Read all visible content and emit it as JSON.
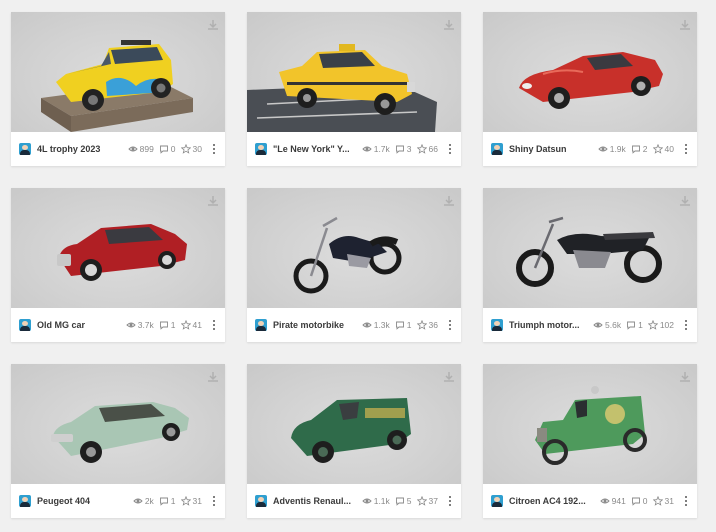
{
  "models": [
    {
      "title": "4L trophy 2023",
      "views": "899",
      "comments": "0",
      "likes": "30",
      "image": "yellow-renault-4l-on-pallet"
    },
    {
      "title": "\"Le New York\" Y...",
      "views": "1.7k",
      "comments": "3",
      "likes": "66",
      "image": "yellow-checker-taxi"
    },
    {
      "title": "Shiny Datsun",
      "views": "1.9k",
      "comments": "2",
      "likes": "40",
      "image": "red-datsun-coupe"
    },
    {
      "title": "Old MG car",
      "views": "3.7k",
      "comments": "1",
      "likes": "41",
      "image": "red-mg-saloon"
    },
    {
      "title": "Pirate motorbike",
      "views": "1.3k",
      "comments": "1",
      "likes": "36",
      "image": "black-cruiser-motorbike"
    },
    {
      "title": "Triumph motor...",
      "views": "5.6k",
      "comments": "1",
      "likes": "102",
      "image": "black-triumph-motorbike"
    },
    {
      "title": "Peugeot 404",
      "views": "2k",
      "comments": "1",
      "likes": "31",
      "image": "pale-green-peugeot-404"
    },
    {
      "title": "Adventis Renaul...",
      "views": "1.1k",
      "comments": "5",
      "likes": "37",
      "image": "green-renault-van"
    },
    {
      "title": "Citroen AC4 192...",
      "views": "941",
      "comments": "0",
      "likes": "31",
      "image": "green-citroen-ac4-van"
    }
  ],
  "icons": {
    "views": "eye-icon",
    "comments": "comment-icon",
    "likes": "star-icon",
    "download": "download-icon",
    "more": "more-vertical-icon"
  },
  "colors": {
    "page_bg": "#f0f0f0",
    "card_bg": "#ffffff",
    "title_text": "#3a3a3a",
    "stat_text": "#8a8a8a",
    "avatar_bg": "#2f9fd0"
  }
}
